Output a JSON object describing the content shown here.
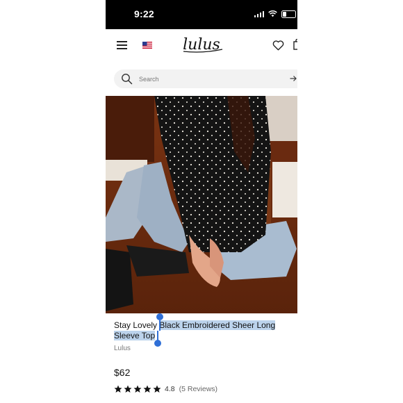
{
  "status_bar": {
    "time": "9:22"
  },
  "header": {
    "logo_text": "lulus"
  },
  "search": {
    "placeholder": "Search"
  },
  "product": {
    "title_unselected": "Stay Lovely ",
    "title_selected": "Black Embroidered Sheer Long Sleeve Top",
    "brand": "Lulus",
    "price": "$62",
    "rating_value": "4.8",
    "review_count": "(5 Reviews)",
    "stars": 5
  },
  "colors": {
    "accent_selection": "#bcd3ec",
    "selection_handle": "#2f6fd6"
  },
  "icons": [
    "menu-icon",
    "us-flag-icon",
    "heart-icon",
    "bag-icon",
    "search-icon",
    "arrow-right-icon",
    "star-icon"
  ]
}
